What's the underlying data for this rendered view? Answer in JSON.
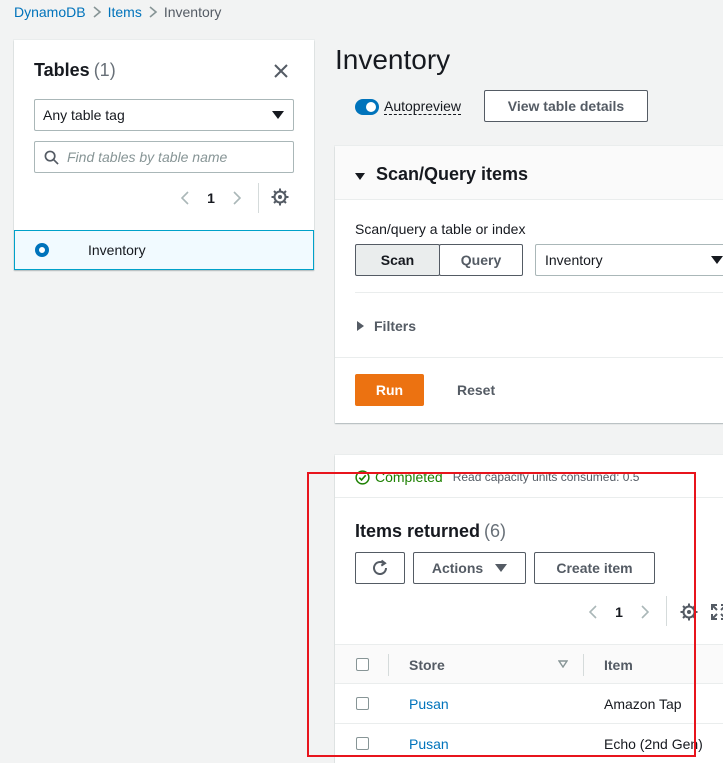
{
  "breadcrumb": [
    {
      "label": "DynamoDB"
    },
    {
      "label": "Items"
    },
    {
      "label": "Inventory"
    }
  ],
  "left_panel": {
    "title": "Tables",
    "count": "(1)",
    "tag_select_value": "Any table tag",
    "find_placeholder": "Find tables by table name",
    "page_number": "1",
    "selected_table": "Inventory"
  },
  "main": {
    "title": "Inventory",
    "autopreview_label": "Autopreview",
    "view_details_label": "View table details"
  },
  "scan_panel": {
    "title": "Scan/Query items",
    "subtitle": "Scan/query a table or index",
    "scan_label": "Scan",
    "query_label": "Query",
    "index_value": "Inventory",
    "filters_label": "Filters",
    "run_label": "Run",
    "reset_label": "Reset"
  },
  "results": {
    "status": "Completed",
    "rcu_text": "Read capacity units consumed: 0.5",
    "title": "Items returned",
    "count": "(6)",
    "actions_label": "Actions",
    "create_label": "Create item",
    "page_number": "1",
    "columns": {
      "store": "Store",
      "item": "Item"
    },
    "rows": [
      {
        "store": "Pusan",
        "item": "Amazon Tap"
      },
      {
        "store": "Pusan",
        "item": "Echo (2nd Gen)"
      }
    ]
  },
  "colors": {
    "link": "#0073bb",
    "primary_button": "#ec7211",
    "success": "#1d8102",
    "highlight_box": "#e8141c"
  }
}
